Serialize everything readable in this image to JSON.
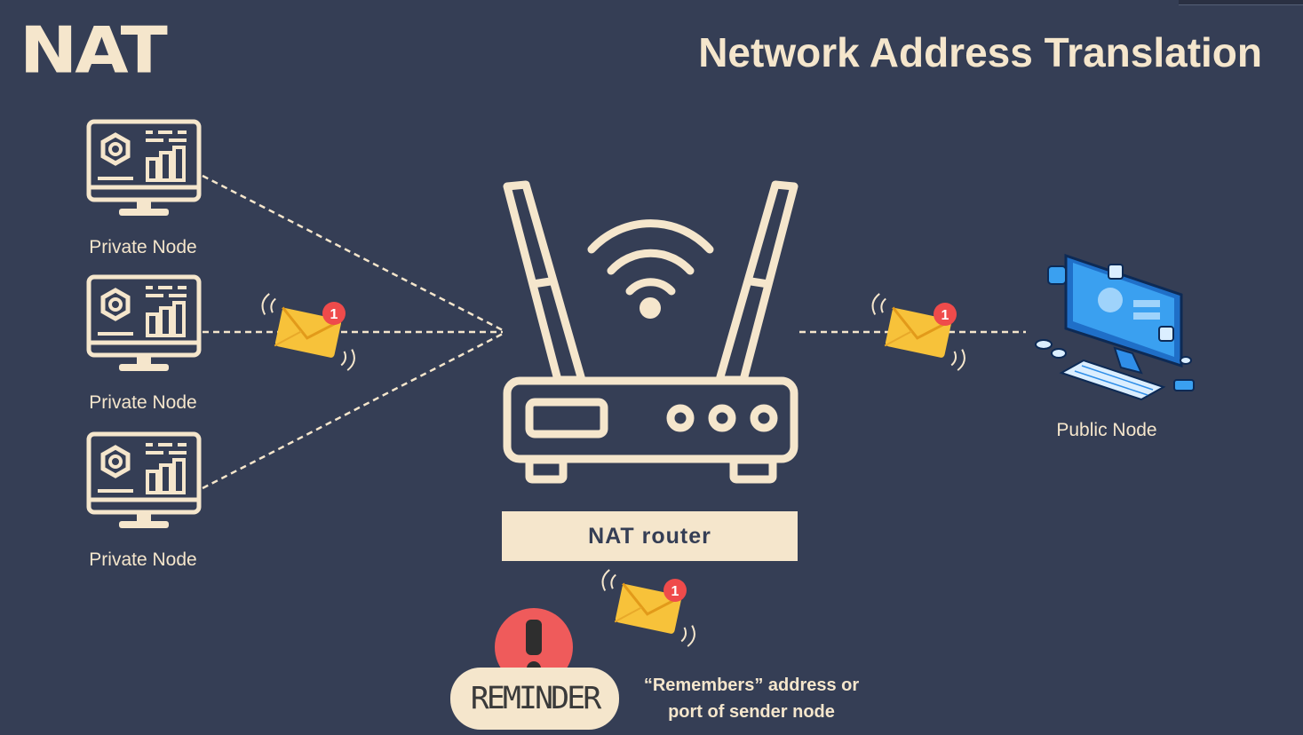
{
  "header": {
    "logo": "NAT",
    "title": "Network Address Translation"
  },
  "nodes": {
    "private": [
      "Private Node",
      "Private Node",
      "Private Node"
    ],
    "public": "Public Node"
  },
  "router": {
    "label": "NAT router"
  },
  "message": {
    "badge_count": "1"
  },
  "reminder": {
    "tag": "REMINDER",
    "text_line1": "“Remembers” address or",
    "text_line2": "port of sender node"
  },
  "colors": {
    "background": "#353e55",
    "cream": "#f5e6cc",
    "envelope": "#f7c23a",
    "badge": "#ef4b4b",
    "public_node_blue": "#2f8ee8"
  }
}
